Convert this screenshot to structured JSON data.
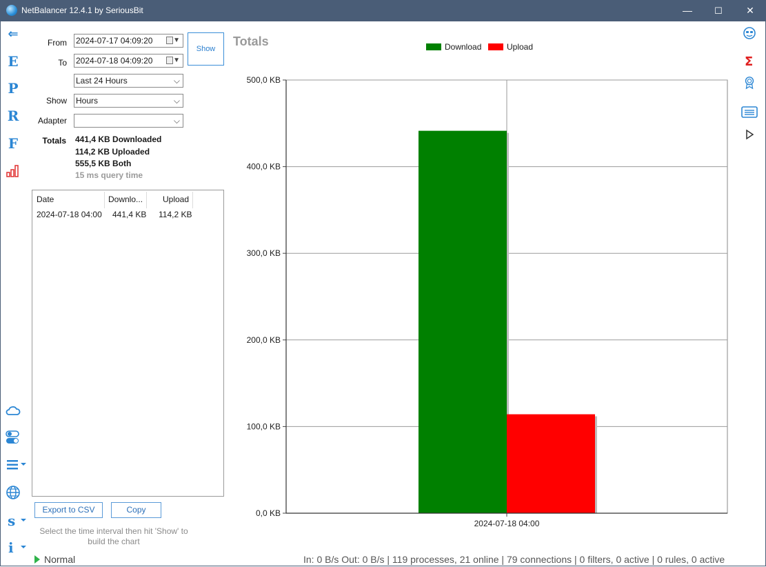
{
  "window": {
    "title": "NetBalancer 12.4.1 by SeriousBit",
    "minimize": "—",
    "maximize": "☐",
    "close": "✕"
  },
  "left_nav": {
    "back": "⇐",
    "e": "E",
    "p": "P",
    "r": "R",
    "f": "F"
  },
  "form": {
    "from_label": "From",
    "from_value": "2024-07-17 04:09:20",
    "to_label": "To",
    "to_value": "2024-07-18 04:09:20",
    "range_value": "Last 24 Hours",
    "show_label": "Show",
    "show_value": "Hours",
    "adapter_label": "Adapter",
    "adapter_value": "",
    "show_button": "Show"
  },
  "totals": {
    "label": "Totals",
    "downloaded": "441,4 KB Downloaded",
    "uploaded": "114,2 KB Uploaded",
    "both": "555,5 KB Both",
    "query_time": "15 ms query time"
  },
  "table": {
    "columns": [
      "Date",
      "Downlo...",
      "Upload"
    ],
    "rows": [
      {
        "date": "2024-07-18 04:00",
        "download": "441,4 KB",
        "upload": "114,2 KB"
      }
    ]
  },
  "buttons": {
    "export_csv": "Export to CSV",
    "copy": "Copy"
  },
  "hint": "Select the time interval then hit 'Show' to build the chart",
  "chart_title": "Totals",
  "chart_data": {
    "type": "bar",
    "categories": [
      "2024-07-18 04:00"
    ],
    "series": [
      {
        "name": "Download",
        "values": [
          441.4
        ],
        "color": "#008000"
      },
      {
        "name": "Upload",
        "values": [
          114.2
        ],
        "color": "#ff0000"
      }
    ],
    "ylim": [
      0,
      500
    ],
    "yticks": [
      "0,0 KB",
      "100,0 KB",
      "200,0 KB",
      "300,0 KB",
      "400,0 KB",
      "500,0 KB"
    ],
    "grid": true,
    "legend": "top"
  },
  "status": {
    "mode": "Normal",
    "stats": "In: 0 B/s  Out: 0 B/s  |  119 processes, 21 online  | 79 connections  | 0 filters, 0 active  |  0 rules, 0 active"
  },
  "icons": [
    "back-arrow-icon",
    "cloud-icon",
    "toggle-icon",
    "menu-icon",
    "globe-icon",
    "sort-icon",
    "info-icon",
    "smiley-icon",
    "sigma-icon",
    "award-icon",
    "list-icon",
    "play-icon"
  ]
}
